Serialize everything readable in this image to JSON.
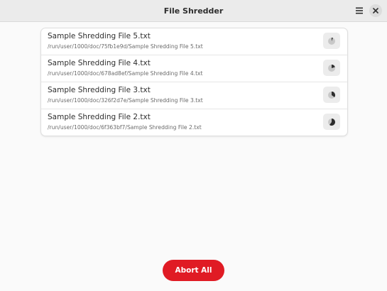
{
  "window": {
    "title": "File Shredder",
    "menu_icon": "hamburger-menu-icon",
    "close_icon": "close-icon"
  },
  "files": [
    {
      "name": "Sample Shredding File 5.txt",
      "path": "/run/user/1000/doc/75fb1e9d/Sample Shredding File 5.txt",
      "progress": 0.06
    },
    {
      "name": "Sample Shredding File 4.txt",
      "path": "/run/user/1000/doc/678ad8ef/Sample Shredding File 4.txt",
      "progress": 0.2
    },
    {
      "name": "Sample Shredding File 3.txt",
      "path": "/run/user/1000/doc/326f2d7e/Sample Shredding File 3.txt",
      "progress": 0.35
    },
    {
      "name": "Sample Shredding File 2.txt",
      "path": "/run/user/1000/doc/6f363bf7/Sample Shredding File 2.txt",
      "progress": 0.6
    }
  ],
  "actions": {
    "abort_all_label": "Abort All"
  },
  "colors": {
    "accent_destructive": "#e01b24",
    "progress_fill": "#2e2e2e",
    "progress_track": "#c8c8c8"
  }
}
